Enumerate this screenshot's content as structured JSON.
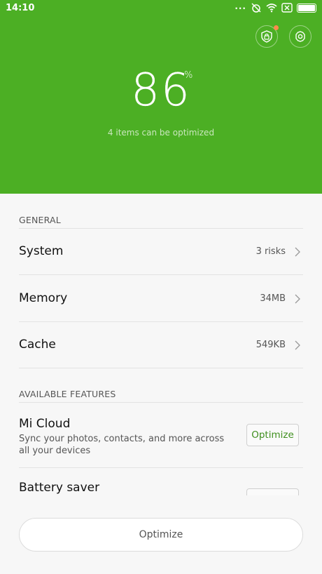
{
  "status_bar": {
    "time": "14:10",
    "dots": "..."
  },
  "hero": {
    "score": "86",
    "unit": "%",
    "subtitle": "4 items can be optimized",
    "background": "#4caf24"
  },
  "general": {
    "title": "GENERAL",
    "rows": [
      {
        "label": "System",
        "value": "3 risks"
      },
      {
        "label": "Memory",
        "value": "34MB"
      },
      {
        "label": "Cache",
        "value": "549KB"
      }
    ]
  },
  "features": {
    "title": "AVAILABLE FEATURES",
    "items": [
      {
        "title": "Mi Cloud",
        "desc": "Sync your photos, contacts, and more across all your devices",
        "button": "Optimize"
      },
      {
        "title": "Battery saver",
        "desc": "",
        "button": ""
      }
    ]
  },
  "footer": {
    "button": "Optimize"
  }
}
